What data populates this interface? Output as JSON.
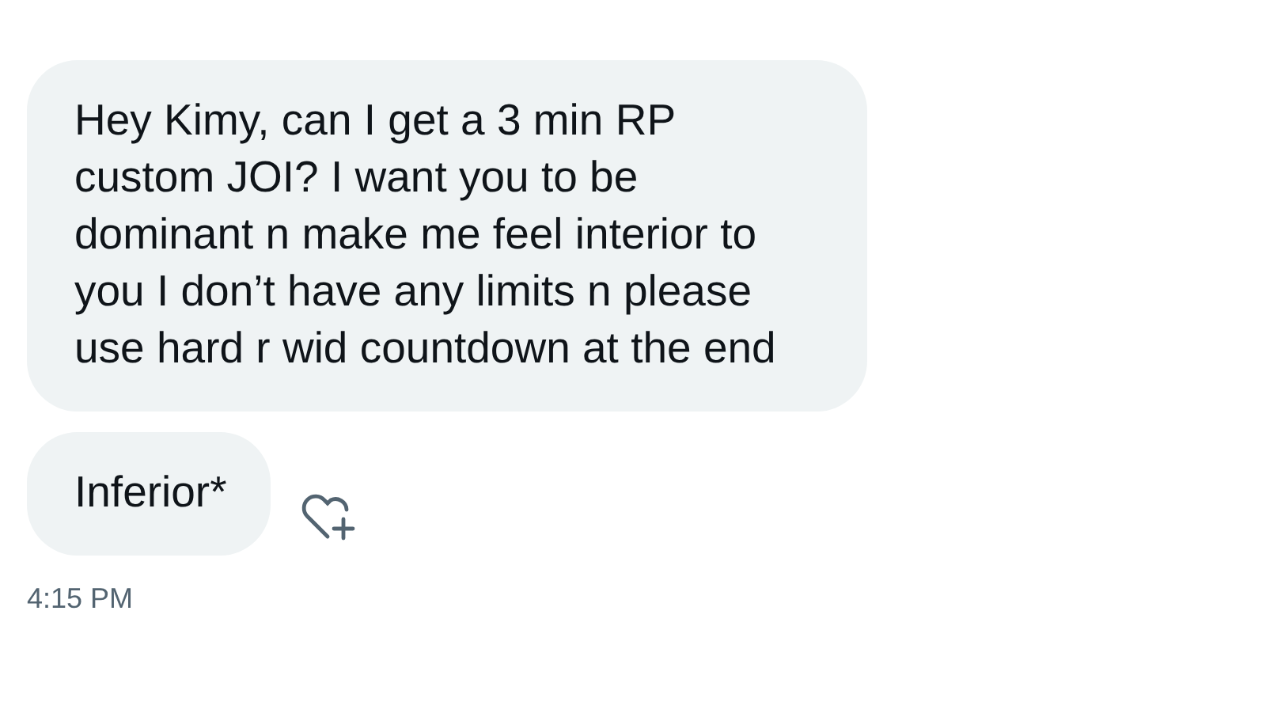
{
  "messages": [
    {
      "text": "Hey Kimy, can I get a 3 min RP custom JOI? I want you to be dominant n make me feel interior to you I don’t have any limits n please use hard r wid countdown at the end"
    },
    {
      "text": "Inferior*",
      "react_button": true
    }
  ],
  "timestamp": "4:15 PM"
}
